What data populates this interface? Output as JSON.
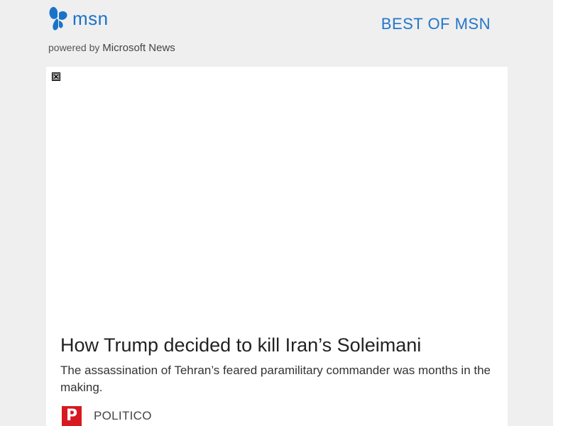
{
  "header": {
    "brand": "msn",
    "powered_by_prefix": "powered by",
    "powered_by_name": "Microsoft News",
    "best_of_label": "BEST OF MSN"
  },
  "article": {
    "headline": "How Trump decided to kill Iran’s Soleimani",
    "summary": "The assassination of Tehran’s feared paramilitary commander was months in the making.",
    "source": {
      "logo_letter": "P",
      "name": "POLITICO"
    }
  },
  "icons": {
    "brand_logo": "butterfly-icon",
    "broken_image": "broken-image-icon"
  },
  "colors": {
    "brand_blue": "#1a73c8",
    "link_blue": "#2376c9",
    "source_red": "#d71920",
    "page_bg": "#efefef"
  }
}
